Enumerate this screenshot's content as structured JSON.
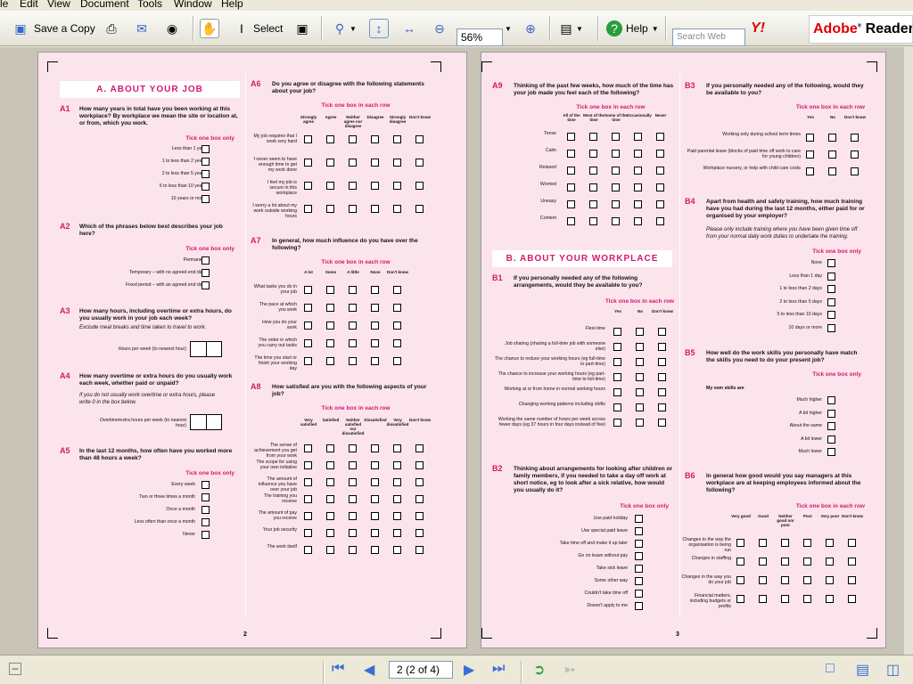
{
  "menu": {
    "items": [
      "le",
      "Edit",
      "View",
      "Document",
      "Tools",
      "Window",
      "Help"
    ]
  },
  "toolbar": {
    "save_copy": "Save a Copy",
    "select": "Select",
    "zoom": "56%",
    "help": "Help",
    "search_placeholder": "Search Web",
    "yahoo": "Y!",
    "brand": "Adobe",
    "brand_product": "Reader",
    "brand_version": "7"
  },
  "status": {
    "page_display": "2 (2 of 4)"
  },
  "page2": {
    "header": "A. ABOUT YOUR JOB",
    "page_number": "2",
    "cols_agree": [
      "Strongly agree",
      "Agree",
      "Neither agree nor disagree",
      "Disagree",
      "Strongly disagree",
      "Don't know"
    ],
    "cols_influence": [
      "A lot",
      "Some",
      "A little",
      "None",
      "Don't know"
    ],
    "cols_satisfied": [
      "Very satisfied",
      "Satisfied",
      "Neither satisfied nor dissatisfied",
      "Dissatisfied",
      "Very dissatisfied",
      "Don't know"
    ],
    "q": [
      {
        "id": "A1",
        "text": "How many years in total have you been working at this workplace? By workplace we mean the site or location at, or from, which you work.",
        "tick": "Tick one box only",
        "options": [
          "Less than 1 year",
          "1 to less than 2 years",
          "2 to less than 5 years",
          "5 to less than 10 years",
          "10 years or more"
        ]
      },
      {
        "id": "A2",
        "text": "Which of the phrases below best describes your job here?",
        "tick": "Tick one box only",
        "options": [
          "Permanent",
          "Temporary – with no agreed end date",
          "Fixed period – with an agreed end date"
        ]
      },
      {
        "id": "A3",
        "text": "How many hours, including overtime or extra hours, do you usually work in your job each week?",
        "sub": "Exclude meal breaks and time taken to travel to work.",
        "label": "Hours per week (to nearest hour)"
      },
      {
        "id": "A4",
        "text": "How many overtime or extra hours do you usually work each week, whether paid or unpaid?",
        "sub": "If you do not usually work overtime or extra hours, please write 0 in the box below.",
        "label": "Overtime/extra hours per week (to nearest hour)"
      },
      {
        "id": "A5",
        "text": "In the last 12 months, how often have you worked more than 48 hours a week?",
        "tick": "Tick one box only",
        "options": [
          "Every week",
          "Two or three times a month",
          "Once a month",
          "Less often than once a month",
          "Never"
        ]
      },
      {
        "id": "A6",
        "text": "Do you agree or disagree with the following statements about your job?",
        "tick": "Tick one box in each row",
        "rows": [
          "My job requires that I work very hard",
          "I never seem to have enough time to get my work done",
          "I feel my job is secure in this workplace",
          "I worry a lot about my work outside working hours"
        ]
      },
      {
        "id": "A7",
        "text": "In general, how much influence do you have over the following?",
        "tick": "Tick one box in each row",
        "rows": [
          "What tasks you do in your job",
          "The pace at which you work",
          "How you do your work",
          "The order in which you carry out tasks",
          "The time you start or finish your working day"
        ]
      },
      {
        "id": "A8",
        "text": "How satisfied are you with the following aspects of your job?",
        "tick": "Tick one box in each row",
        "rows": [
          "The sense of achievement you get from your work",
          "The scope for using your own initiative",
          "The amount of influence you have over your job",
          "The training you receive",
          "The amount of pay you receive",
          "Your job security",
          "The work itself"
        ]
      }
    ]
  },
  "page3": {
    "header": "B. ABOUT YOUR WORKPLACE",
    "page_number": "3",
    "cols_time": [
      "All of the time",
      "Most of the time",
      "Some of the time",
      "Occasionally",
      "Never"
    ],
    "cols_ynd": [
      "Yes",
      "No",
      "Don't know"
    ],
    "cols_good": [
      "Very good",
      "Good",
      "Neither good nor poor",
      "Poor",
      "Very poor",
      "Don't know"
    ],
    "q": [
      {
        "id": "A9",
        "text": "Thinking of the past few weeks, how much of the time has your job made you feel each of the following?",
        "tick": "Tick one box in each row",
        "rows": [
          "Tense",
          "Calm",
          "Relaxed",
          "Worried",
          "Uneasy",
          "Content"
        ]
      },
      {
        "id": "B1",
        "text": "If you personally needed any of the following arrangements, would they be available to you?",
        "tick": "Tick one box in each row",
        "rows": [
          "Flexi-time",
          "Job sharing (sharing a full-time job with someone else)",
          "The chance to reduce your working hours (eg full-time to part-time)",
          "The chance to increase your working hours (eg part-time to full-time)",
          "Working at or from home in normal working hours",
          "Changing working patterns including shifts",
          "Working the same number of hours per week across fewer days (eg 37 hours in four days instead of five)"
        ]
      },
      {
        "id": "B2",
        "text": "Thinking about arrangements for looking after children or family members, if you needed to take a day off work at short notice, eg to look after a sick relative, how would you usually do it?",
        "tick": "Tick one box only",
        "options": [
          "Use paid holiday",
          "Use special paid leave",
          "Take time off and make it up later",
          "Go on leave without pay",
          "Take sick leave",
          "Some other way",
          "Couldn't take time off",
          "Doesn't apply to me"
        ]
      },
      {
        "id": "B3",
        "text": "If you personally needed any of the following, would they be available to you?",
        "tick": "Tick one box in each row",
        "rows": [
          "Working only during school term times",
          "Paid parental leave (blocks of paid time off work to care for young children)",
          "Workplace nursery, or help with child care costs"
        ]
      },
      {
        "id": "B4",
        "text": "Apart from health and safety training, how much training have you had during the last 12 months, either paid for or organised by your employer?",
        "sub": "Please only include training where you have been given time off from your normal daily work duties to undertake the training.",
        "tick": "Tick one box only",
        "options": [
          "None",
          "Less than 1 day",
          "1 to less than 2 days",
          "2 to less than 5 days",
          "5 to less than 10 days",
          "10 days or more"
        ]
      },
      {
        "id": "B5",
        "text": "How well do the work skills you personally have match the skills you need to do your present job?",
        "tick": "Tick one box only",
        "lead": "My own skills are",
        "options": [
          "Much higher",
          "A bit higher",
          "About the same",
          "A bit lower",
          "Much lower"
        ]
      },
      {
        "id": "B6",
        "text": "In general how good would you say managers at this workplace are at keeping employees informed about the following?",
        "tick": "Tick one box in each row",
        "rows": [
          "Changes to the way the organisation is being run",
          "Changes in staffing",
          "Changes in the way you do your job",
          "Financial matters, including budgets or profits"
        ]
      }
    ]
  }
}
